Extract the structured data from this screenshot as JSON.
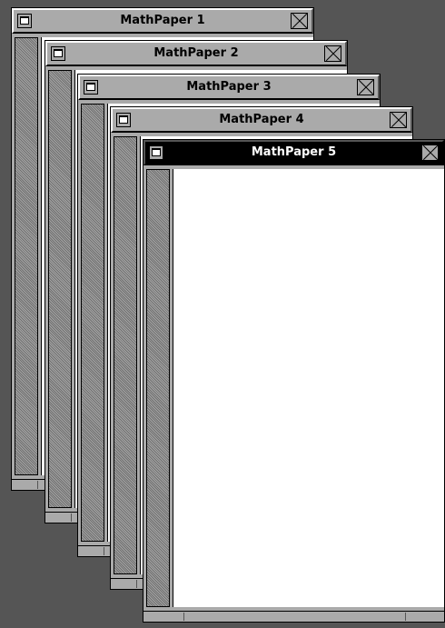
{
  "desktop": {
    "background": "#555555"
  },
  "windows": [
    {
      "title": "MathPaper 1",
      "active": false
    },
    {
      "title": "MathPaper 2",
      "active": false
    },
    {
      "title": "MathPaper 3",
      "active": false
    },
    {
      "title": "MathPaper 4",
      "active": false
    },
    {
      "title": "MathPaper 5",
      "active": true
    }
  ],
  "icons": {
    "miniaturize": "miniaturize-icon",
    "close": "close-icon"
  },
  "colors": {
    "window_gray": "#aaaaaa",
    "active_titlebar": "#000000",
    "inactive_titlebar": "#aaaaaa",
    "content_background": "#ffffff"
  }
}
